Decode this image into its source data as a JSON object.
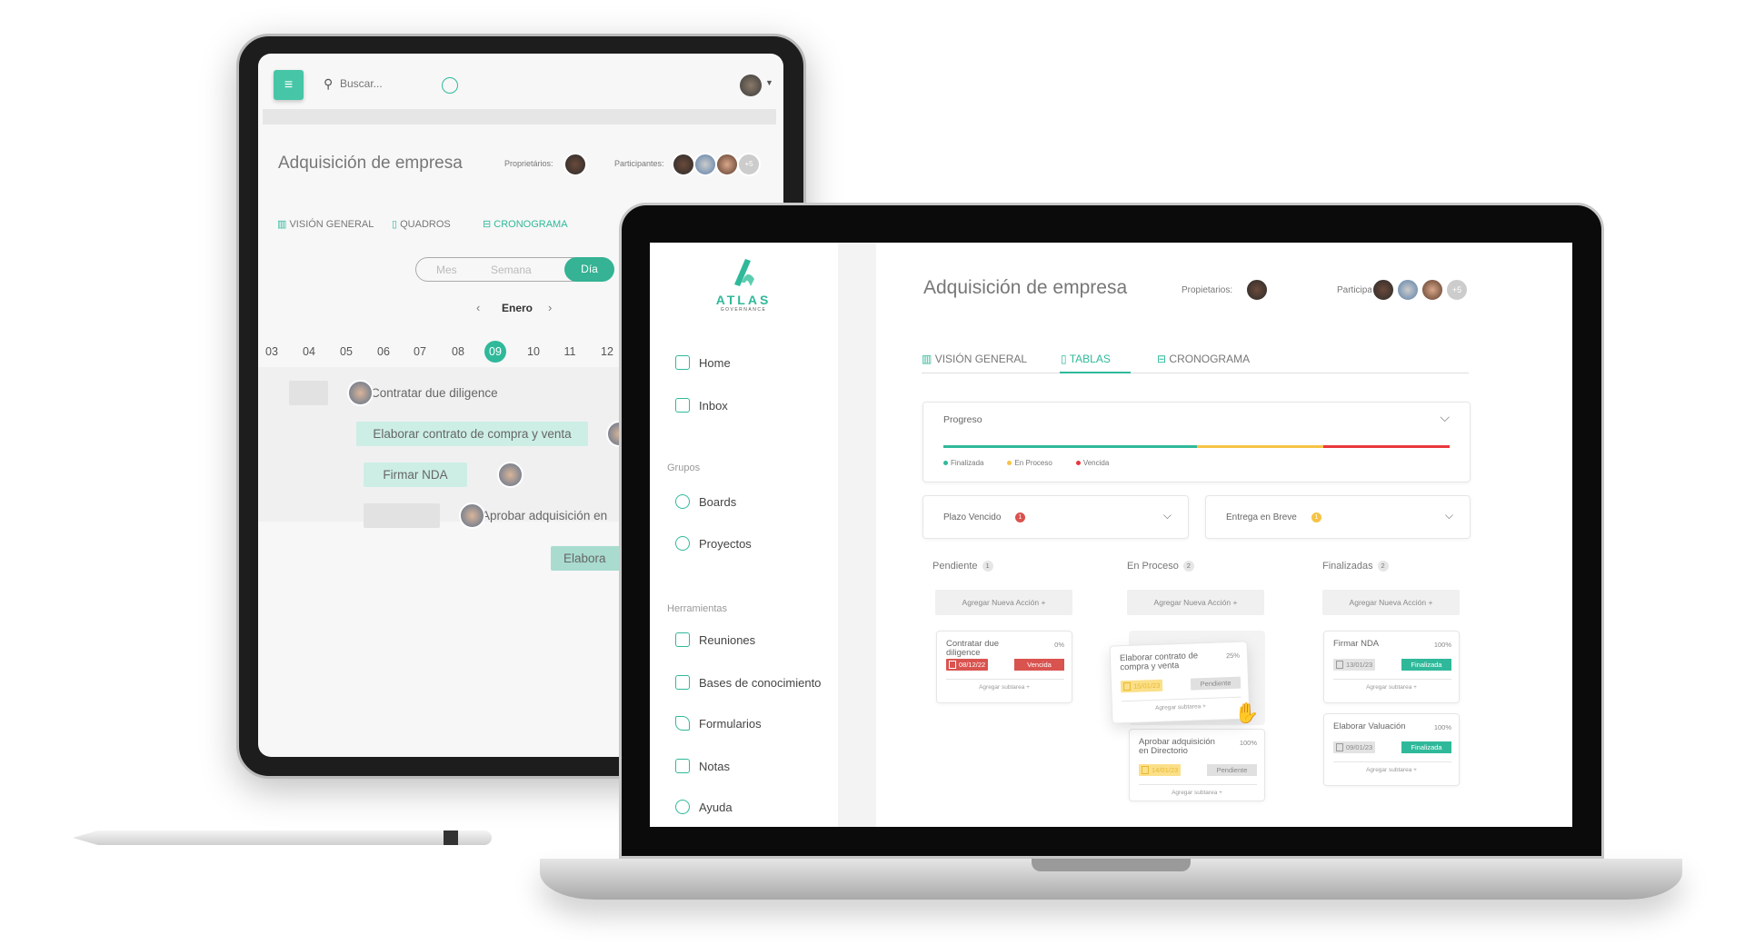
{
  "colors": {
    "accent": "#2fb99a",
    "danger": "#d9534f",
    "warning": "#f6c344",
    "neutral": "#dcdcdc"
  },
  "tablet": {
    "search_placeholder": "Buscar...",
    "title": "Adquisición de empresa",
    "owners_label": "Proprietários:",
    "participants_label": "Participantes:",
    "participants_more": "+5",
    "tabs": [
      {
        "label": "VISIÓN GENERAL",
        "icon": "bar-chart-icon"
      },
      {
        "label": "QUADROS",
        "icon": "board-icon"
      },
      {
        "label": "CRONOGRAMA",
        "icon": "timeline-icon",
        "active": true
      }
    ],
    "view_modes": [
      {
        "label": "Mes"
      },
      {
        "label": "Semana"
      },
      {
        "label": "Día",
        "active": true
      }
    ],
    "month": "Enero",
    "days": [
      "03",
      "04",
      "05",
      "06",
      "07",
      "08",
      "09",
      "10",
      "11",
      "12"
    ],
    "selected_day": "09",
    "gantt": [
      {
        "label": "Contratar due diligence"
      },
      {
        "label": "Elaborar contrato de compra y venta"
      },
      {
        "label": "Firmar NDA"
      },
      {
        "label": "Aprobar adquisición en"
      },
      {
        "label": "Elabora"
      }
    ]
  },
  "laptop": {
    "logo": {
      "name": "ATLAS",
      "sub": "GOVERNANCE"
    },
    "sidebar": {
      "items": [
        {
          "label": "Home",
          "icon": "home-icon"
        },
        {
          "label": "Inbox",
          "icon": "inbox-icon"
        }
      ],
      "groups_label": "Grupos",
      "groups": [
        {
          "label": "Boards",
          "icon": "users-icon"
        },
        {
          "label": "Proyectos",
          "icon": "share-icon"
        }
      ],
      "tools_label": "Herramientas",
      "tools": [
        {
          "label": "Reuniones",
          "icon": "calendar-icon"
        },
        {
          "label": "Bases de conocimiento",
          "icon": "book-icon"
        },
        {
          "label": "Formularios",
          "icon": "pen-icon"
        },
        {
          "label": "Notas",
          "icon": "note-icon"
        },
        {
          "label": "Ayuda",
          "icon": "help-icon"
        }
      ]
    },
    "title": "Adquisición de empresa",
    "owners_label": "Propietarios:",
    "participants_label": "Participantes:",
    "participants_more": "+5",
    "tabs": [
      {
        "label": "VISIÓN GENERAL"
      },
      {
        "label": "TABLAS",
        "active": true
      },
      {
        "label": "CRONOGRAMA"
      }
    ],
    "progress": {
      "label": "Progreso",
      "segments": [
        {
          "label": "Finalizada",
          "percent": 50,
          "color": "#2fb99a"
        },
        {
          "label": "En Proceso",
          "percent": 25,
          "color": "#f6c344"
        },
        {
          "label": "Vencida",
          "percent": 25,
          "color": "#e8383d"
        }
      ]
    },
    "filters": [
      {
        "label": "Plazo Vencido",
        "count": "1",
        "color": "#d9534f"
      },
      {
        "label": "Entrega en Breve",
        "count": "1",
        "color": "#f6c344"
      }
    ],
    "columns": [
      {
        "title": "Pendiente",
        "count": "1",
        "add_label": "Agregar Nueva Acción +",
        "cards": [
          {
            "title": "Contratar due diligence",
            "percent": "0%",
            "date": "08/12/22",
            "status": "Vencida",
            "subtask": "Agregar subtarea +",
            "kind": "overdue"
          }
        ]
      },
      {
        "title": "En Proceso",
        "count": "2",
        "add_label": "Agregar Nueva Acción +",
        "cards": [
          {
            "title": "Elaborar contrato de compra y venta",
            "percent": "25%",
            "date": "15/01/23",
            "status": "Pendiente",
            "subtask": "Agregar subtarea +",
            "kind": "pending",
            "dragging": true
          },
          {
            "title": "Aprobar adquisición en Directorio",
            "percent": "100%",
            "date": "14/01/23",
            "status": "Pendiente",
            "subtask": "Agregar subtarea +",
            "kind": "pending"
          }
        ]
      },
      {
        "title": "Finalizadas",
        "count": "2",
        "add_label": "Agregar Nueva Acción +",
        "cards": [
          {
            "title": "Firmar NDA",
            "percent": "100%",
            "date": "13/01/23",
            "status": "Finalizada",
            "subtask": "Agregar subtarea +",
            "kind": "done"
          },
          {
            "title": "Elaborar Valuación",
            "percent": "100%",
            "date": "09/01/23",
            "status": "Finalizada",
            "subtask": "Agregar subtarea +",
            "kind": "done"
          }
        ]
      }
    ]
  }
}
